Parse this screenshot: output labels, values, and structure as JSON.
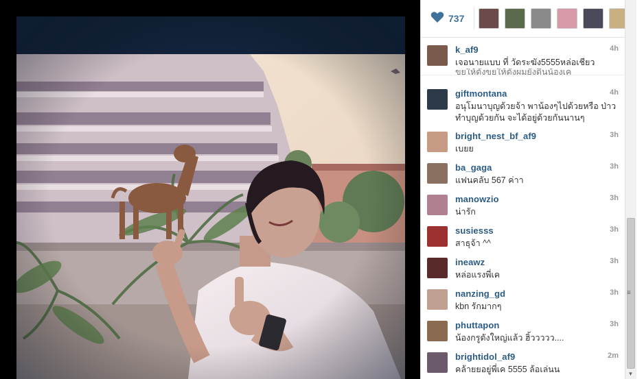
{
  "likes": {
    "count": "737"
  },
  "comments": [
    {
      "user": "k_af9",
      "time": "4h",
      "text": "เจอนายแบบ ที่ วัดระฆัง5555หล่อเชียว",
      "avatar_color": "#7a5a4a"
    },
    {
      "user": "giftmontana",
      "time": "4h",
      "text": "อนุโมนาบุญด้วยจ้า พาน้องๆไปด้วยหรือ ป่าว ทำบุญด้วยกัน จะได้อยู่ด้วยกันนานๆ",
      "avatar_color": "#2d3a4a"
    },
    {
      "user": "bright_nest_bf_af9",
      "time": "3h",
      "text": "เบยย",
      "avatar_color": "#c79a83"
    },
    {
      "user": "ba_gaga",
      "time": "3h",
      "text": "แฟนคลับ 567 ค่าา",
      "avatar_color": "#8a7060"
    },
    {
      "user": "manowzio",
      "time": "3h",
      "text": "น่ารัก",
      "avatar_color": "#b08090"
    },
    {
      "user": "susiesss",
      "time": "3h",
      "text": "สาธุจ้า ^^",
      "avatar_color": "#9a3030"
    },
    {
      "user": "ineawz",
      "time": "3h",
      "text": "หล่อแรงพี่เค",
      "avatar_color": "#5a2a2a"
    },
    {
      "user": "nanzing_gd",
      "time": "3h",
      "text": "kbn รักมากๆ",
      "avatar_color": "#c0a090"
    },
    {
      "user": "phuttapon",
      "time": "3h",
      "text": "น้องกรูดังใหญ่แล้ว ฮิ้ววววว....",
      "avatar_color": "#8a6a50"
    },
    {
      "user": "brightidol_af9",
      "time": "2m",
      "text": "คล้ายยอยู่พี่เค 5555 ล้อเล่นน",
      "avatar_color": "#6a5a6a"
    }
  ],
  "partial_comment_text": "ขยให้ดังขยให้ดังผมยังดีนน้องเค"
}
